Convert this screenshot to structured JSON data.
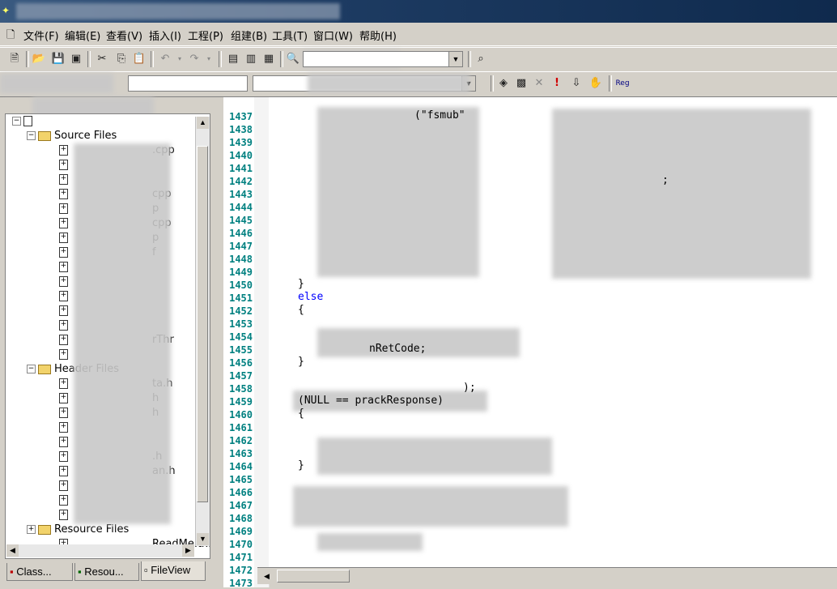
{
  "menu": {
    "items": [
      "文件(F)",
      "编辑(E)",
      "查看(V)",
      "插入(I)",
      "工程(P)",
      "组建(B)",
      "工具(T)",
      "窗口(W)",
      "帮助(H)"
    ]
  },
  "toolbar": {
    "reg_label": "Reg"
  },
  "tree": {
    "rows": [
      {
        "label": "Source Files",
        "type": "folder"
      },
      {
        "label": ".cpp",
        "type": "file"
      },
      {
        "label": "",
        "type": "file"
      },
      {
        "label": "",
        "type": "file"
      },
      {
        "label": "cpp",
        "type": "file"
      },
      {
        "label": "p",
        "type": "file"
      },
      {
        "label": "cpp",
        "type": "file"
      },
      {
        "label": "p",
        "type": "file"
      },
      {
        "label": "f",
        "type": "file"
      },
      {
        "label": "",
        "type": "file"
      },
      {
        "label": "",
        "type": "file"
      },
      {
        "label": "",
        "type": "file"
      },
      {
        "label": "",
        "type": "file"
      },
      {
        "label": "",
        "type": "file"
      },
      {
        "label": "rThr",
        "type": "file"
      },
      {
        "label": "",
        "type": "file"
      },
      {
        "label": "Header Files",
        "type": "folder"
      },
      {
        "label": "ta.h",
        "type": "file"
      },
      {
        "label": "h",
        "type": "file"
      },
      {
        "label": "h",
        "type": "file"
      },
      {
        "label": "",
        "type": "file"
      },
      {
        "label": "",
        "type": "file"
      },
      {
        "label": ".h",
        "type": "file"
      },
      {
        "label": "an.h",
        "type": "file"
      },
      {
        "label": "",
        "type": "file"
      },
      {
        "label": "",
        "type": "file"
      },
      {
        "label": "",
        "type": "file"
      },
      {
        "label": "Resource Files",
        "type": "folder"
      },
      {
        "label": "ReadMe.txt",
        "type": "file"
      }
    ]
  },
  "tabs": [
    {
      "label": "Class..."
    },
    {
      "label": "Resou..."
    },
    {
      "label": "FileView"
    }
  ],
  "editor": {
    "line_numbers": [
      "1437",
      "1438",
      "1439",
      "1440",
      "1441",
      "1442",
      "1443",
      "1444",
      "1445",
      "1446",
      "1447",
      "1448",
      "1449",
      "1450",
      "1451",
      "1452",
      "1453",
      "1454",
      "1455",
      "1456",
      "1457",
      "1458",
      "1459",
      "1460",
      "1461",
      "1462",
      "1463",
      "1464",
      "1465",
      "1466",
      "1467",
      "1468",
      "1469",
      "1470",
      "1471",
      "1472",
      "1473"
    ],
    "code_lines": [
      {
        "line": "1437",
        "text": "(\"fsmub\"",
        "kw": false
      },
      {
        "line": "1442",
        "text": ";",
        "kw": false
      },
      {
        "line": "1450",
        "text": "}",
        "kw": false
      },
      {
        "line": "1451",
        "text": "else",
        "kw": true
      },
      {
        "line": "1452",
        "text": "{",
        "kw": false
      },
      {
        "line": "1455",
        "text": "nRetCode;",
        "kw": false
      },
      {
        "line": "1456",
        "text": "}",
        "kw": false
      },
      {
        "line": "1458",
        "text": ");",
        "kw": false
      },
      {
        "line": "1459",
        "text": "(NULL == prackResponse)",
        "kw": false
      },
      {
        "line": "1460",
        "text": "{",
        "kw": false
      },
      {
        "line": "1464",
        "text": "}",
        "kw": false
      }
    ]
  }
}
